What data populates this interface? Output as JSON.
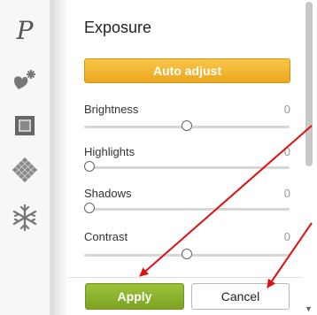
{
  "panel": {
    "title": "Exposure",
    "auto_adjust_label": "Auto adjust",
    "sliders": [
      {
        "label": "Brightness",
        "value": "0",
        "position": 0.5
      },
      {
        "label": "Highlights",
        "value": "0",
        "position": 0.0
      },
      {
        "label": "Shadows",
        "value": "0",
        "position": 0.0
      },
      {
        "label": "Contrast",
        "value": "0",
        "position": 0.5
      }
    ],
    "apply_label": "Apply",
    "cancel_label": "Cancel"
  },
  "toolbar": {
    "tools": [
      {
        "icon": "text-p-icon"
      },
      {
        "icon": "sticker-icon"
      },
      {
        "icon": "frame-icon"
      },
      {
        "icon": "texture-icon"
      },
      {
        "icon": "snowflake-icon"
      }
    ],
    "first_tool_glyph": "P"
  },
  "colors": {
    "auto_adjust": "#f0b030",
    "apply": "#8ab32c",
    "annotation_arrow": "#e01010"
  }
}
